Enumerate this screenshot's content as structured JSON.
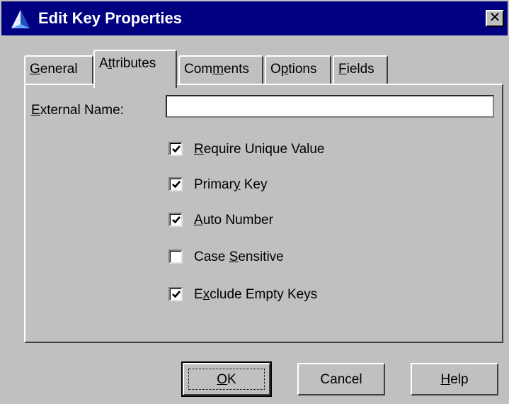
{
  "window": {
    "title": "Edit Key Properties",
    "close_glyph": "✕",
    "icon": "app-triangle-icon"
  },
  "tabs": [
    {
      "label": "General",
      "active": false
    },
    {
      "label": "Attributes",
      "active": true
    },
    {
      "label": "Comments",
      "active": false
    },
    {
      "label": "Options",
      "active": false
    },
    {
      "label": "Fields",
      "active": false
    }
  ],
  "form": {
    "external_name_label": "External Name:",
    "external_name_value": "",
    "external_name_placeholder": ""
  },
  "checkboxes": [
    {
      "label": "Require Unique Value",
      "checked": true
    },
    {
      "label": "Primary Key",
      "checked": true
    },
    {
      "label": "Auto Number",
      "checked": true
    },
    {
      "label": "Case Sensitive",
      "checked": false
    },
    {
      "label": "Exclude Empty Keys",
      "checked": true
    }
  ],
  "buttons": {
    "ok": "OK",
    "cancel": "Cancel",
    "help": "Help"
  },
  "colors": {
    "titlebar": "#000080",
    "face": "#c0c0c0"
  }
}
